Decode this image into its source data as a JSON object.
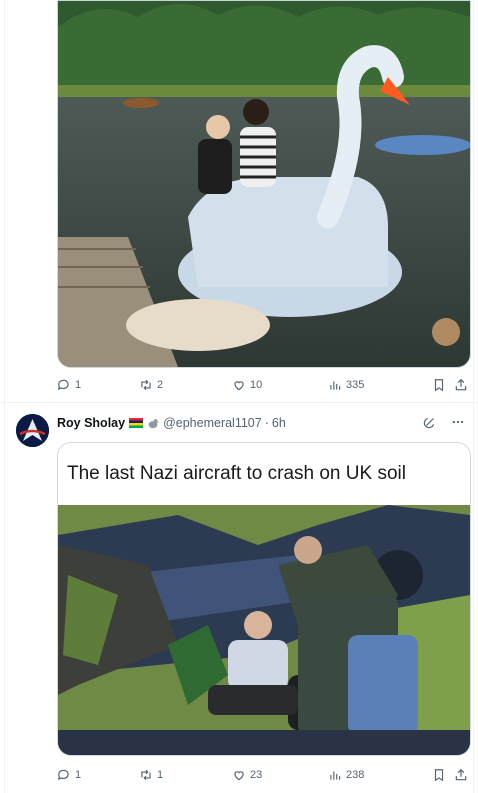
{
  "posts": [
    {
      "id": "post-1",
      "media_description": "swan pedal boat meme image",
      "stats": {
        "replies": "1",
        "reposts": "2",
        "likes": "10",
        "views": "335"
      }
    },
    {
      "id": "post-2",
      "author": {
        "name": "Roy Sholay",
        "handle": "@ephemeral1107",
        "time": "6h"
      },
      "caption": "The last Nazi aircraft to crash on UK soil",
      "stats": {
        "replies": "1",
        "reposts": "1",
        "likes": "23",
        "views": "238"
      }
    }
  ],
  "colors": {
    "text": "#0f1419",
    "muted": "#536471",
    "border": "#cfd9de",
    "divider": "#eff3f4"
  },
  "icons": [
    "reply-icon",
    "repost-icon",
    "like-icon",
    "views-icon",
    "bookmark-icon",
    "share-icon",
    "grok-icon",
    "more-icon"
  ]
}
